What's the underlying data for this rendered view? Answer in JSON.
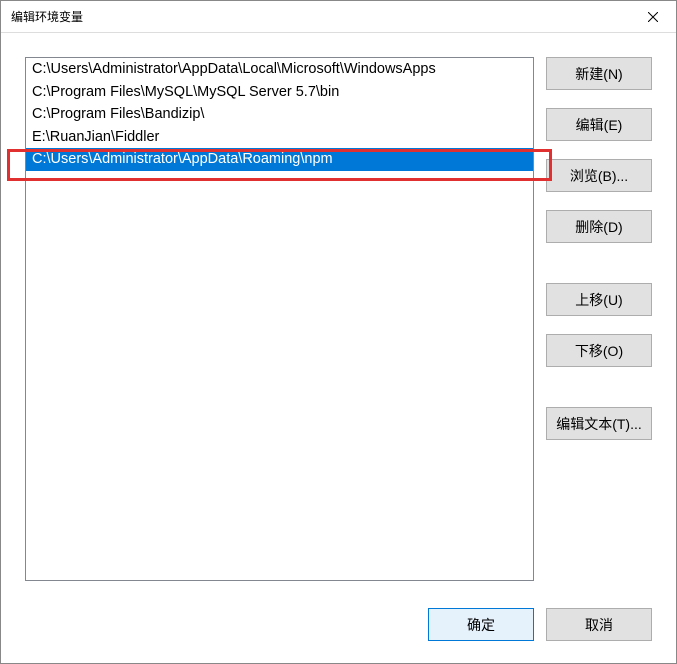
{
  "title": "编辑环境变量",
  "list": {
    "items": [
      "C:\\Users\\Administrator\\AppData\\Local\\Microsoft\\WindowsApps",
      "C:\\Program Files\\MySQL\\MySQL Server 5.7\\bin",
      "C:\\Program Files\\Bandizip\\",
      "E:\\RuanJian\\Fiddler",
      "C:\\Users\\Administrator\\AppData\\Roaming\\npm"
    ],
    "selected_index": 4
  },
  "buttons": {
    "new": "新建(N)",
    "edit": "编辑(E)",
    "browse": "浏览(B)...",
    "delete": "删除(D)",
    "move_up": "上移(U)",
    "move_down": "下移(O)",
    "edit_text": "编辑文本(T)...",
    "ok": "确定",
    "cancel": "取消"
  }
}
